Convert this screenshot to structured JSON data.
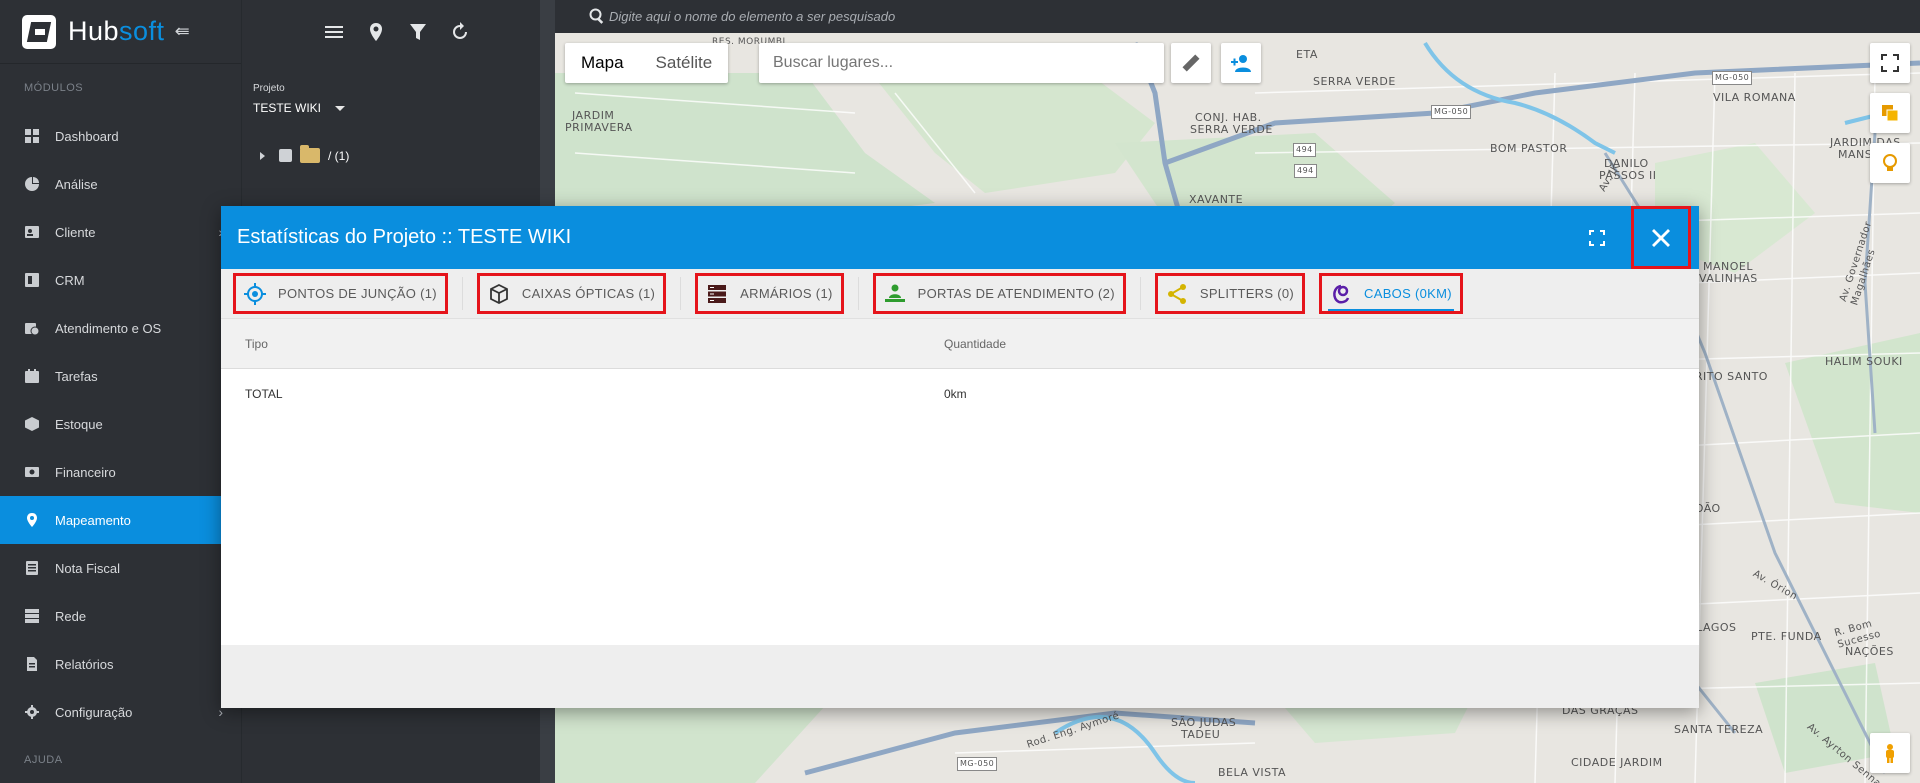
{
  "app": {
    "brand_part1": "Hub",
    "brand_part2": "soft",
    "brand_color": "#0a8ede"
  },
  "sidebar": {
    "section_label": "MÓDULOS",
    "help_label": "AJUDA",
    "items": [
      {
        "label": "Dashboard",
        "icon": "dashboard-icon"
      },
      {
        "label": "Análise",
        "icon": "pie-chart-icon"
      },
      {
        "label": "Cliente",
        "icon": "contact-card-icon",
        "has_submenu": true
      },
      {
        "label": "CRM",
        "icon": "crm-icon"
      },
      {
        "label": "Atendimento e OS",
        "icon": "calendar-clock-icon"
      },
      {
        "label": "Tarefas",
        "icon": "task-calendar-icon"
      },
      {
        "label": "Estoque",
        "icon": "box-icon"
      },
      {
        "label": "Financeiro",
        "icon": "money-icon"
      },
      {
        "label": "Mapeamento",
        "icon": "map-pin-icon",
        "active": true
      },
      {
        "label": "Nota Fiscal",
        "icon": "document-icon"
      },
      {
        "label": "Rede",
        "icon": "server-icon"
      },
      {
        "label": "Relatórios",
        "icon": "report-icon"
      },
      {
        "label": "Configuração",
        "icon": "gear-icon",
        "has_submenu": true
      }
    ]
  },
  "project_panel": {
    "project_label": "Projeto",
    "project_value": "TESTE WIKI",
    "tree_root": "/ (1)"
  },
  "map": {
    "search_placeholder": "Digite aqui o nome do elemento a ser pesquisado",
    "map_type_map": "Mapa",
    "map_type_satellite": "Satélite",
    "places_placeholder": "Buscar lugares...",
    "labels": {
      "serra_verde": "SERRA VERDE",
      "vila_romana": "VILA ROMANA",
      "jardim_primavera_1": "JARDIM",
      "jardim_primavera_2": "PRIMAVERA",
      "conj_hab_1": "CONJ. HAB.",
      "conj_hab_2": "SERRA VERDE",
      "bom_pastor": "BOM PASTOR",
      "xavante": "XAVANTE",
      "danilo_1": "DANILO",
      "danilo_2": "PASSOS II",
      "jardim_das_1": "JARDIM DAS",
      "jardim_das_2": "MANSÕ",
      "manoel_1": "MANOEL",
      "manoel_2": "VALINHAS",
      "halim": "HALIM SOUKI",
      "espirito": "PIRITO SANTO",
      "joao": "JOÃO",
      "rlagos": "RLAGOS",
      "pte_funda": "PTE. FUNDA",
      "nacoes": "NAÇÕES",
      "das_gracas": "DAS GRAÇAS",
      "santa_tereza": "SANTA TEREZA",
      "sao_judas_1": "SÃO JUDAS",
      "sao_judas_2": "TADEU",
      "cidade_jardim": "CIDADE JARDIM",
      "bela_vista": "BELA VISTA",
      "eta": "ETA",
      "res_morumbi": "RES. MORUMBI",
      "av_orion": "Av. Órion",
      "r_bom_sucesso": "R. Bom Sucesso",
      "rod_eng": "Rod. Eng. Aymoré",
      "av_governador": "Av. Governador Magalhães",
      "av_jk": "Av. JK",
      "av_ayrton": "Av. Ayrton Senna",
      "road_mg050_1": "MG-050",
      "road_mg050_2": "MG-050",
      "road_mg050_3": "MG-050",
      "road_494_1": "494",
      "road_494_2": "494"
    }
  },
  "modal": {
    "title": "Estatísticas do Projeto :: TESTE WIKI",
    "tabs": [
      {
        "label": "PONTOS DE JUNÇÃO (1)",
        "icon": "crosshair-icon",
        "color": "#0a8ede"
      },
      {
        "label": "CAIXAS ÓPTICAS (1)",
        "icon": "cube-icon",
        "color": "#333333"
      },
      {
        "label": "ARMÁRIOS (1)",
        "icon": "cabinet-icon",
        "color": "#5a1a1a"
      },
      {
        "label": "PORTAS DE ATENDIMENTO (2)",
        "icon": "person-desk-icon",
        "color": "#2e9c2e"
      },
      {
        "label": "SPLITTERS (0)",
        "icon": "share-icon",
        "color": "#d4b400"
      },
      {
        "label": "CABOS (0KM)",
        "icon": "cable-icon",
        "color": "#5b1fa8",
        "active": true
      }
    ],
    "table": {
      "columns": [
        "Tipo",
        "Quantidade"
      ],
      "rows": [
        [
          "TOTAL",
          "0km"
        ]
      ]
    }
  }
}
